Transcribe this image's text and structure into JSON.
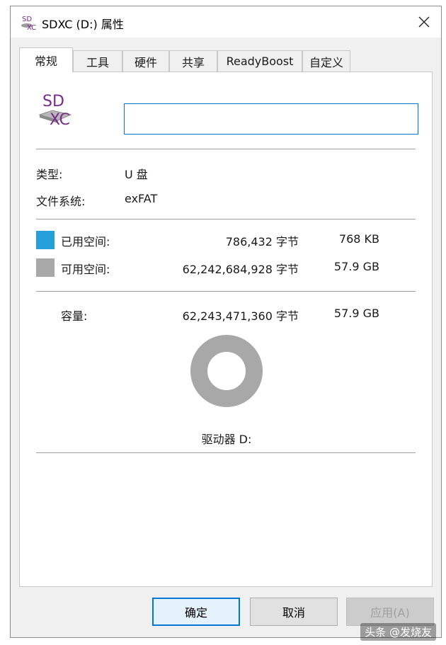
{
  "window": {
    "title": "SDXC (D:) 属性",
    "icon": "sdxc-drive-icon"
  },
  "tabs": [
    {
      "label": "常规",
      "active": true
    },
    {
      "label": "工具",
      "active": false
    },
    {
      "label": "硬件",
      "active": false
    },
    {
      "label": "共享",
      "active": false
    },
    {
      "label": "ReadyBoost",
      "active": false
    },
    {
      "label": "自定义",
      "active": false
    }
  ],
  "general": {
    "drive_icon_text_top": "SD",
    "drive_icon_text_bottom": "XC",
    "name_value": "",
    "type_label": "类型:",
    "type_value": "U 盘",
    "fs_label": "文件系统:",
    "fs_value": "exFAT",
    "used": {
      "label": "已用空间:",
      "bytes": "786,432 字节",
      "size": "768 KB",
      "color": "#26a0da"
    },
    "free": {
      "label": "可用空间:",
      "bytes": "62,242,684,928 字节",
      "size": "57.9 GB",
      "color": "#a8a8a8"
    },
    "capacity": {
      "label": "容量:",
      "bytes": "62,243,471,360 字节",
      "size": "57.9 GB"
    },
    "used_fraction": 1.26e-05,
    "drive_label": "驱动器 D:"
  },
  "buttons": {
    "ok": "确定",
    "cancel": "取消",
    "apply": "应用(A)"
  },
  "watermark": "头条 @发烧友"
}
